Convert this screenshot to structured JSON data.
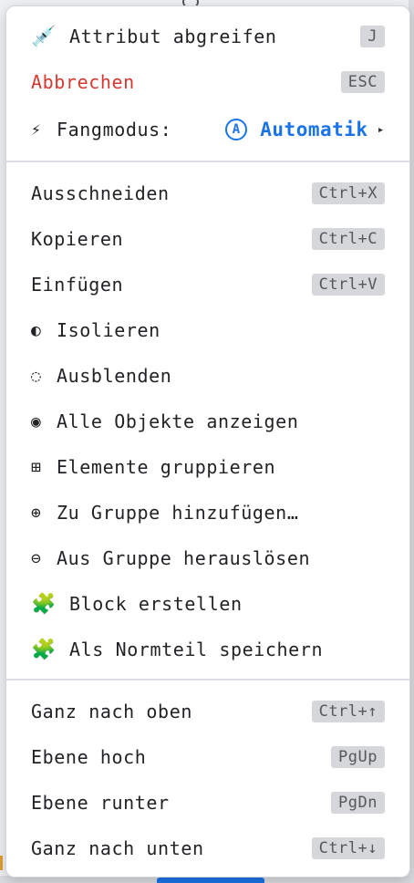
{
  "menu": {
    "pick_attribute": {
      "icon": "💉",
      "label": "Attribut abgreifen",
      "shortcut": "J"
    },
    "cancel": {
      "label": "Abbrechen",
      "shortcut": "ESC"
    },
    "snap_mode": {
      "icon": "⚡",
      "label": "Fangmodus:",
      "badge": "A",
      "value": "Automatik",
      "chevron": "▸"
    },
    "edit": [
      {
        "label": "Ausschneiden",
        "shortcut": "Ctrl+X"
      },
      {
        "label": "Kopieren",
        "shortcut": "Ctrl+C"
      },
      {
        "label": "Einfügen",
        "shortcut": "Ctrl+V"
      }
    ],
    "visibility": [
      {
        "icon": "◐",
        "label": "Isolieren"
      },
      {
        "icon": "◌",
        "label": "Ausblenden"
      },
      {
        "icon": "◉",
        "label": "Alle Objekte anzeigen"
      }
    ],
    "grouping": [
      {
        "icon": "⊞",
        "label": "Elemente gruppieren"
      },
      {
        "icon": "⊕",
        "label": "Zu Gruppe hinzufügen…"
      },
      {
        "icon": "⊖",
        "label": "Aus Gruppe herauslösen"
      }
    ],
    "blocks": [
      {
        "icon": "🧩",
        "label": "Block erstellen"
      },
      {
        "icon": "🧩",
        "label": "Als Normteil speichern"
      }
    ],
    "arrange": [
      {
        "label": "Ganz nach oben",
        "shortcut": "Ctrl+↑"
      },
      {
        "label": "Ebene hoch",
        "shortcut": "PgUp"
      },
      {
        "label": "Ebene runter",
        "shortcut": "PgDn"
      },
      {
        "label": "Ganz nach unten",
        "shortcut": "Ctrl+↓"
      }
    ]
  },
  "colors": {
    "accent": "#1a73e8",
    "danger": "#d8372f",
    "kbd_bg": "#d5d7da",
    "puzzle": "#3fa63a"
  }
}
